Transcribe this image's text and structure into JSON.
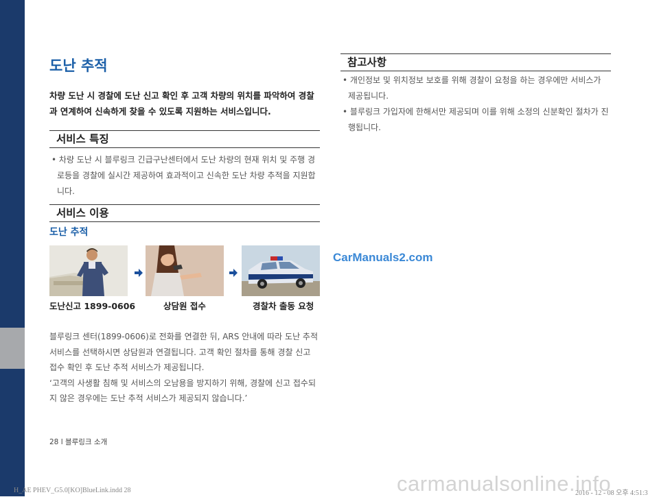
{
  "page": {
    "title": "도난 추적",
    "lead": "차량 도난 시 경찰에 도난 신고 확인 후 고객 차량의 위치를 파악하여 경찰과 연계하여 신속하게 찾을 수 있도록 지원하는 서비스입니다.",
    "features_heading": "서비스 특징",
    "features_bullet": "차량 도난 시 블루링크 긴급구난센터에서 도난 차량의 현재 위치 및 주행 경로등을 경찰에 실시간 제공하여 효과적이고 신속한 도난 차량 추적을 지원합니다.",
    "usage_heading": "서비스 이용",
    "usage_subtitle": "도난 추적",
    "steps": [
      {
        "caption": "도난신고 1899-0606",
        "image": "man-at-car-illustration"
      },
      {
        "caption": "상담원 접수",
        "image": "call-agent-illustration"
      },
      {
        "caption": "경찰차 출동 요청",
        "image": "police-car-illustration"
      }
    ],
    "arrow_icon": "right-arrow-icon",
    "body_paragraph1": "블루링크 센터(1899-0606)로 전화를 연결한 뒤, ARS 안내에 따라 도난 추적 서비스를 선택하시면 상담원과 연결됩니다. 고객 확인 절차를 통해 경찰 신고 접수 확인 후 도난 추적 서비스가 제공됩니다.",
    "body_paragraph2": "‘고객의 사생활 침해 및 서비스의 오남용을 방지하기 위해, 경찰에 신고 접수되지 않은 경우에는 도난 추적 서비스가 제공되지 않습니다.’",
    "reference_heading": "참고사항",
    "reference_bullets": [
      "개인정보 및 위치정보 보호를 위해 경찰이 요청을 하는 경우에만 서비스가 제공됩니다.",
      "블루링크 가입자에 한해서만 제공되며 이를 위해 소정의 신분확인 절차가 진행됩니다."
    ],
    "footer": "28 l 블루링크 소개",
    "watermark_site": "CarManuals2.com",
    "bottom_file": "H_AE PHEV_G5.0[KO]BlueLink.indd   28",
    "bottom_date": "2016 - 12 - 08   오후 4:51:3",
    "bottom_watermark": "carmanualsonline.info"
  },
  "colors": {
    "sidebar": "#1b3a6b",
    "sidebar_tab": "#a7a9ac",
    "accent_blue": "#1b5fa8",
    "arrow_blue": "#1a4f9c",
    "watermark_blue": "#3a88d6"
  }
}
